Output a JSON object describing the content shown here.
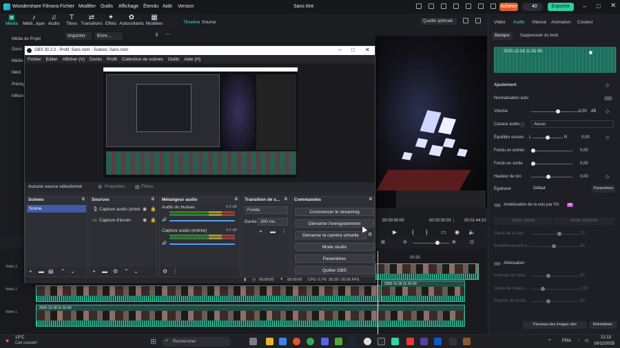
{
  "filmora": {
    "app_title": "Wondershare Filmora",
    "menu": [
      "Fichier",
      "Modifier",
      "Outils",
      "Affichage",
      "Étendu",
      "Aide",
      "Version"
    ],
    "doc_title": "Sans titre",
    "buy_label": "Acheter",
    "credits": "40",
    "export_label": "Exporter",
    "toolbar": [
      "Média",
      "Médi...ique",
      "Audio",
      "Titres",
      "Transitions",
      "Effets",
      "Autocollants",
      "Modèles"
    ],
    "left_panel": [
      "Média de Projet",
      "Dossi",
      "Média",
      "Médi",
      "Prérégl",
      "Influen"
    ],
    "import_label": "Importer",
    "record_label": "Enre...",
    "player_tabs": [
      "Timeline",
      "Source"
    ],
    "quality": "Qualité optimale",
    "timecode_current": "00:00:00:00",
    "timecode_total": "00:01:44:10",
    "timeline_marker": "00:30",
    "clip_name": "2025-12-18 11-31-00",
    "track_labels": [
      "Vidéo 3",
      "Vidéo 2",
      "Vidéo 1"
    ]
  },
  "right_panel": {
    "tabs": [
      "Vidéo",
      "Audio",
      "Vitesse",
      "Animation",
      "Couleur"
    ],
    "subtabs": [
      "Basique",
      "Suppression du bruit"
    ],
    "clip": "2025-12-18 11-31-55",
    "section": "Ajustement",
    "auto_norm": "Normalisation auto",
    "volume": "Volume",
    "volume_value": "0,00",
    "volume_unit": "dB",
    "channels": "Canaux audio",
    "channels_value": "Aucun",
    "balance": "Équilibre sonore",
    "balance_l": "L",
    "balance_r": "R",
    "balance_value": "0,00",
    "fade_in": "Fondu en entrée",
    "fade_in_value": "0,00",
    "fade_out": "Fondu en sortie",
    "fade_out_value": "0,00",
    "pitch": "Hauteur de ton",
    "pitch_value": "0,00",
    "eq": "Égaliseur",
    "eq_value": "Défaut",
    "eq_button": "Paramètres",
    "ai_voice": "Amélioration de la voix par l'IA",
    "ai_badge": "AI",
    "voice_buttons": [
      "Mode rapide",
      "Mode amélioré"
    ],
    "voice_params": [
      [
        "Clarté de la voix",
        "70"
      ],
      [
        "Embellissement d...",
        "50"
      ]
    ],
    "attenuation": "Atténuation",
    "att_params": [
      [
        "Intensité de l'atté...",
        "50"
      ],
      [
        "Durée de l'atténu...",
        "1,00"
      ],
      [
        "Position de fondu",
        "50"
      ]
    ],
    "bottom_buttons": [
      "Panneau des images clés",
      "Réinitialiser"
    ]
  },
  "obs": {
    "title": "OBS 30.2.3 - Profil: Sans nom - Scènes: Sans nom",
    "menu": [
      "Fichier",
      "Editer",
      "Afficher (V)",
      "Docks",
      "Profil",
      "Collection de scènes",
      "Outils",
      "Aide (H)"
    ],
    "no_source": "Aucune source sélectionné",
    "properties": "Propriétés",
    "filters": "Filtres",
    "docks": {
      "scenes": {
        "title": "Scènes",
        "items": [
          "Scène"
        ]
      },
      "sources": {
        "title": "Sources",
        "items": [
          "Capture audio (entré",
          "Capture d'écran"
        ]
      },
      "mixer": {
        "title": "Mélangeur audio",
        "channels": [
          {
            "name": "Audio du bureau",
            "db": "0.0 dB"
          },
          {
            "name": "Capture audio (entrée)",
            "db": "0.0 dB"
          }
        ]
      },
      "transitions": {
        "title": "Transition de s...",
        "type": "Fondu",
        "duration_label": "Durée",
        "duration_value": "300 ms"
      },
      "controls": {
        "title": "Commandes",
        "buttons": [
          "Commencer le streaming",
          "Démarrer l'enregistrement",
          "Démarrer la caméra virtuelle",
          "Mode studio",
          "Paramètres",
          "Quitter OBS"
        ]
      }
    },
    "status": {
      "rec_time": "00:00:00",
      "stream_time": "00:00:00",
      "cpu": "CPU: 0.7%",
      "fps": "30.00 / 30.00 FPS"
    }
  },
  "taskbar": {
    "weather_temp": "13°C",
    "weather_desc": "Ciel couvert",
    "search_placeholder": "Rechercher",
    "lang": "FRA",
    "time": "12:13",
    "date": "16/12/2025"
  }
}
